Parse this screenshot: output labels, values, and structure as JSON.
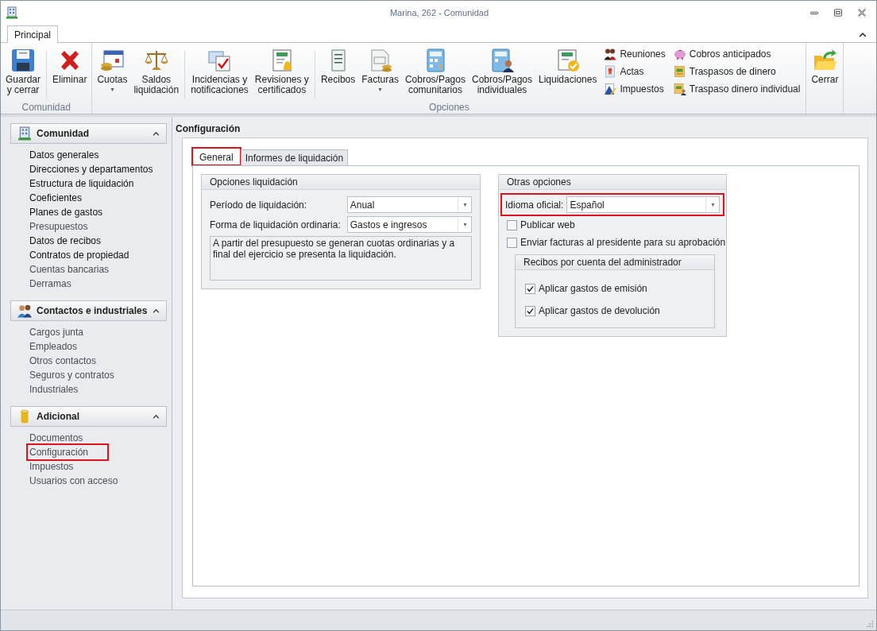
{
  "window": {
    "title": "Marina, 262 - Comunidad"
  },
  "ribbon": {
    "tabs": [
      {
        "label": "Principal",
        "selected": true
      }
    ],
    "groups": [
      {
        "label": "Comunidad",
        "items": [
          {
            "kind": "large",
            "label": "Guardar\ny cerrar",
            "dropdown": false
          },
          {
            "kind": "separator"
          },
          {
            "kind": "large",
            "label": "Eliminar",
            "dropdown": false
          }
        ]
      },
      {
        "label": "Opciones",
        "items": [
          {
            "kind": "large",
            "label": "Cuotas",
            "dropdown": true
          },
          {
            "kind": "large",
            "label": "Saldos\nliquidación",
            "dropdown": false
          },
          {
            "kind": "separator"
          },
          {
            "kind": "large",
            "label": "Incidencias y\nnotificaciones",
            "dropdown": false
          },
          {
            "kind": "large",
            "label": "Revisiones y\ncertificados",
            "dropdown": false
          },
          {
            "kind": "separator"
          },
          {
            "kind": "large",
            "label": "Recibos",
            "dropdown": false
          },
          {
            "kind": "large",
            "label": "Facturas",
            "dropdown": true
          },
          {
            "kind": "large",
            "label": "Cobros/Pagos\ncomunitarios",
            "dropdown": false
          },
          {
            "kind": "large",
            "label": "Cobros/Pagos\nindividuales",
            "dropdown": false
          },
          {
            "kind": "large",
            "label": "Liquidaciones",
            "dropdown": false
          },
          {
            "kind": "column",
            "buttons": [
              "Reuniones",
              "Actas",
              "Impuestos"
            ]
          },
          {
            "kind": "column",
            "buttons": [
              "Cobros anticipados",
              "Traspasos de dinero",
              "Traspaso dinero individual"
            ]
          }
        ]
      },
      {
        "items": [
          {
            "kind": "large",
            "label": "Cerrar",
            "dropdown": false
          }
        ]
      }
    ]
  },
  "sidebar": {
    "panels": [
      {
        "title": "Comunidad",
        "expanded": true,
        "items": [
          {
            "label": "Datos generales",
            "dimmed": false,
            "highlighted": false
          },
          {
            "label": "Direcciones y departamentos",
            "dimmed": false,
            "highlighted": false
          },
          {
            "label": "Estructura de liquidación",
            "dimmed": false,
            "highlighted": false
          },
          {
            "label": "Coeficientes",
            "dimmed": false,
            "highlighted": false
          },
          {
            "label": "Planes de gastos",
            "dimmed": false,
            "highlighted": false
          },
          {
            "label": "Presupuestos",
            "dimmed": true,
            "highlighted": false
          },
          {
            "label": "Datos de recibos",
            "dimmed": false,
            "highlighted": false
          },
          {
            "label": "Contratos de propiedad",
            "dimmed": false,
            "highlighted": false
          },
          {
            "label": "Cuentas bancarias",
            "dimmed": true,
            "highlighted": false
          },
          {
            "label": "Derramas",
            "dimmed": true,
            "highlighted": false
          }
        ]
      },
      {
        "title": "Contactos e industriales",
        "expanded": true,
        "items": [
          {
            "label": "Cargos junta",
            "dimmed": true,
            "highlighted": false
          },
          {
            "label": "Empleados",
            "dimmed": true,
            "highlighted": false
          },
          {
            "label": "Otros contactos",
            "dimmed": true,
            "highlighted": false
          },
          {
            "label": "Seguros y contratos",
            "dimmed": true,
            "highlighted": false
          },
          {
            "label": "Industriales",
            "dimmed": true,
            "highlighted": false
          }
        ]
      },
      {
        "title": "Adicional",
        "expanded": true,
        "items": [
          {
            "label": "Documentos",
            "dimmed": true,
            "highlighted": false
          },
          {
            "label": "Configuración",
            "dimmed": true,
            "highlighted": true
          },
          {
            "label": "Impuestos",
            "dimmed": true,
            "highlighted": false
          },
          {
            "label": "Usuarios con acceso",
            "dimmed": true,
            "highlighted": false
          }
        ]
      }
    ]
  },
  "content": {
    "title": "Configuración",
    "tabs": [
      {
        "label": "General",
        "selected": true,
        "highlighted": true
      },
      {
        "label": "Informes de liquidación",
        "selected": false,
        "highlighted": false
      }
    ],
    "liquidacion": {
      "title": "Opciones liquidación",
      "fields": [
        {
          "label": "Período de liquidación:",
          "value": "Anual"
        },
        {
          "label": "Forma de liquidación ordinaria:",
          "value": "Gastos e ingresos"
        }
      ],
      "description": "A partir del presupuesto se generan cuotas ordinarias y a final del ejercicio se presenta la liquidación."
    },
    "otras": {
      "title": "Otras opciones",
      "language": {
        "label": "Idioma oficial:",
        "value": "Español",
        "highlighted": true
      },
      "options": [
        {
          "label": "Publicar web",
          "checked": false
        },
        {
          "label": "Enviar facturas al presidente para su aprobación",
          "checked": false
        }
      ],
      "recibos": {
        "title": "Recibos por cuenta del administrador",
        "options": [
          {
            "label": "Aplicar gastos de emisión",
            "checked": true
          },
          {
            "label": "Aplicar gastos de devolución",
            "checked": true
          }
        ]
      }
    }
  }
}
